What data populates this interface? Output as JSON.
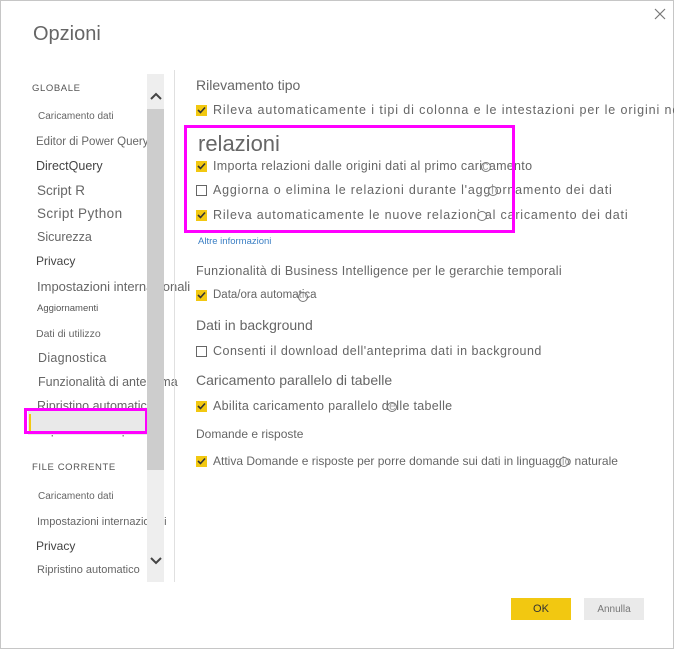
{
  "dialog": {
    "title": "Opzioni",
    "close_icon": "close-icon"
  },
  "sidebar": {
    "global_header": "GLOBALE",
    "global_items": [
      {
        "label": "Caricamento dati"
      },
      {
        "label": "Editor di Power Query"
      },
      {
        "label": "DirectQuery"
      },
      {
        "label": "Script R"
      },
      {
        "label": "Script Python"
      },
      {
        "label": "Sicurezza"
      },
      {
        "label": "Privacy"
      },
      {
        "label": "Impostazioni internazionali"
      },
      {
        "label": "Aggiornamenti"
      },
      {
        "label": "Dati di utilizzo"
      },
      {
        "label": "Diagnostica"
      },
      {
        "label": "Funzionalità di anteprima"
      },
      {
        "label": "Ripristino automatico"
      },
      {
        "label": "Impostazioni report"
      }
    ],
    "file_header": "FILE CORRENTE",
    "file_items": [
      {
        "label": "Caricamento dati",
        "selected": true
      },
      {
        "label": "Impostazioni internazionali"
      },
      {
        "label": "Privacy"
      },
      {
        "label": "Ripristino automatico"
      }
    ]
  },
  "main": {
    "type_detection": {
      "heading": "Rilevamento tipo",
      "option": {
        "label": "Rileva automaticamente i tipi di colonna e le intestazioni per le origini non stru",
        "checked": true
      }
    },
    "relationships": {
      "heading": "relazioni",
      "options": [
        {
          "label": "Importa relazioni dalle origini dati al primo caricamento",
          "checked": true
        },
        {
          "label": "Aggiorna o elimina le relazioni durante l'aggiornamento dei dati",
          "checked": false
        },
        {
          "label": "Rileva automaticamente le nuove relazioni al caricamento dei dati",
          "checked": true
        }
      ],
      "more_info_link": "Altre informazioni"
    },
    "time_intelligence": {
      "heading": "Funzionalità di Business Intelligence per le gerarchie temporali",
      "option": {
        "label": "Data/ora automatica",
        "checked": true
      }
    },
    "background_data": {
      "heading": "Dati in background",
      "option": {
        "label": "Consenti il download dell'anteprima dati in background",
        "checked": false
      }
    },
    "parallel_loading": {
      "heading": "Caricamento parallelo di tabelle",
      "option": {
        "label": "Abilita caricamento parallelo delle tabelle",
        "checked": true
      }
    },
    "qna": {
      "heading": "Domande e risposte",
      "option": {
        "label": "Attiva Domande e risposte per porre domande sui dati in linguaggio naturale",
        "checked": true
      }
    }
  },
  "footer": {
    "ok_label": "OK",
    "cancel_label": "Annulla"
  },
  "colors": {
    "accent_yellow": "#f2c811",
    "highlight_magenta": "#ff00ff",
    "link_blue": "#3b7fc4"
  }
}
